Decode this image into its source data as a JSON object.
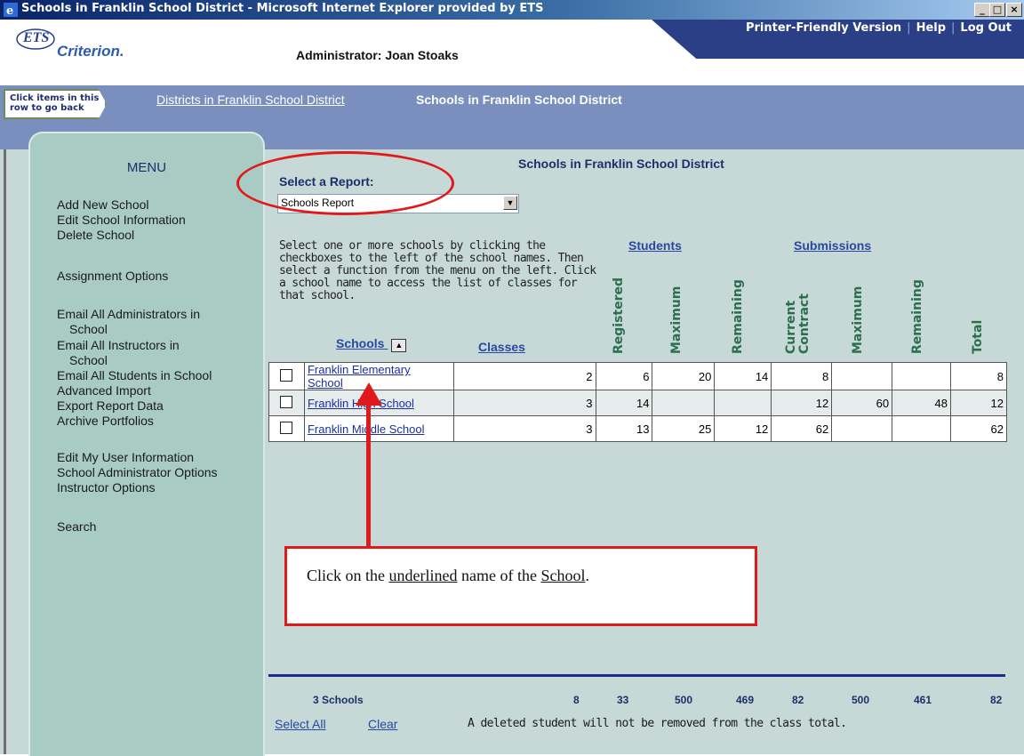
{
  "window": {
    "title": "Schools in Franklin School District - Microsoft Internet Explorer provided by ETS",
    "controls": [
      "_",
      "□",
      "×"
    ]
  },
  "header": {
    "logo_ets": "ETS",
    "logo_product": "Criterion.",
    "administrator": "Administrator: Joan Stoaks",
    "links": {
      "printer": "Printer-Friendly Version",
      "help": "Help",
      "logout": "Log Out",
      "separator": "|"
    }
  },
  "breadcrumb": {
    "back_hint": "Click items in this row to go back",
    "items": [
      "Districts in Franklin School District",
      "Schools in Franklin School District"
    ]
  },
  "menu": {
    "title": "MENU",
    "items": [
      "Add New School",
      "Edit School Information",
      "Delete School",
      "Assignment Options",
      "Email All Administrators in",
      "School",
      "Email All Instructors in",
      "School",
      "Email All Students in School",
      "Advanced Import",
      "Export Report Data",
      "Archive Portfolios",
      "Edit My User Information",
      "School Administrator Options",
      "Instructor Options",
      "Search"
    ]
  },
  "content": {
    "title": "Schools in Franklin School District",
    "report_label": "Select a Report:",
    "report_value": "Schools Report",
    "instructions": "Select one or more schools by clicking the checkboxes to the left of the school names. Then select a function from the menu on the left. Click a school name to access the list of classes for that school."
  },
  "table": {
    "groups": {
      "students": "Students",
      "submissions": "Submissions"
    },
    "columns": {
      "schools": "Schools",
      "classes": "Classes",
      "registered": "Registered",
      "s_maximum": "Maximum",
      "s_remaining": "Remaining",
      "current_contract_1": "Current",
      "current_contract_2": "Contract",
      "sub_maximum": "Maximum",
      "sub_remaining": "Remaining",
      "total": "Total"
    },
    "rows": [
      {
        "school_1": "Franklin Elementary",
        "school_2": "School",
        "classes": "2",
        "registered": "6",
        "s_max": "20",
        "s_rem": "14",
        "contract": "8",
        "sub_max": "",
        "sub_rem": "",
        "total": "8"
      },
      {
        "school": "Franklin High School",
        "classes": "3",
        "registered": "14",
        "s_max": "",
        "s_rem": "",
        "contract": "12",
        "sub_max": "60",
        "sub_rem": "48",
        "total": "12"
      },
      {
        "school": "Franklin Middle School",
        "classes": "3",
        "registered": "13",
        "s_max": "25",
        "s_rem": "12",
        "contract": "62",
        "sub_max": "",
        "sub_rem": "",
        "total": "62"
      }
    ],
    "totals": {
      "label": "3 Schools",
      "classes": "8",
      "registered": "33",
      "s_max": "500",
      "s_rem": "469",
      "contract": "82",
      "sub_max": "500",
      "sub_rem": "461",
      "total": "82"
    }
  },
  "footer": {
    "select_all": "Select All",
    "clear": "Clear",
    "note": "A deleted student will not be removed from the class total."
  },
  "callout": {
    "pre": "Click on the ",
    "underlined": "underlined",
    "mid": " name of the ",
    "school": "School",
    "post": "."
  },
  "colors": {
    "accent": "#2b3f87",
    "annotation": "#e01a1a",
    "panel": "#c7d9d6",
    "menu": "#a8cbc4"
  }
}
